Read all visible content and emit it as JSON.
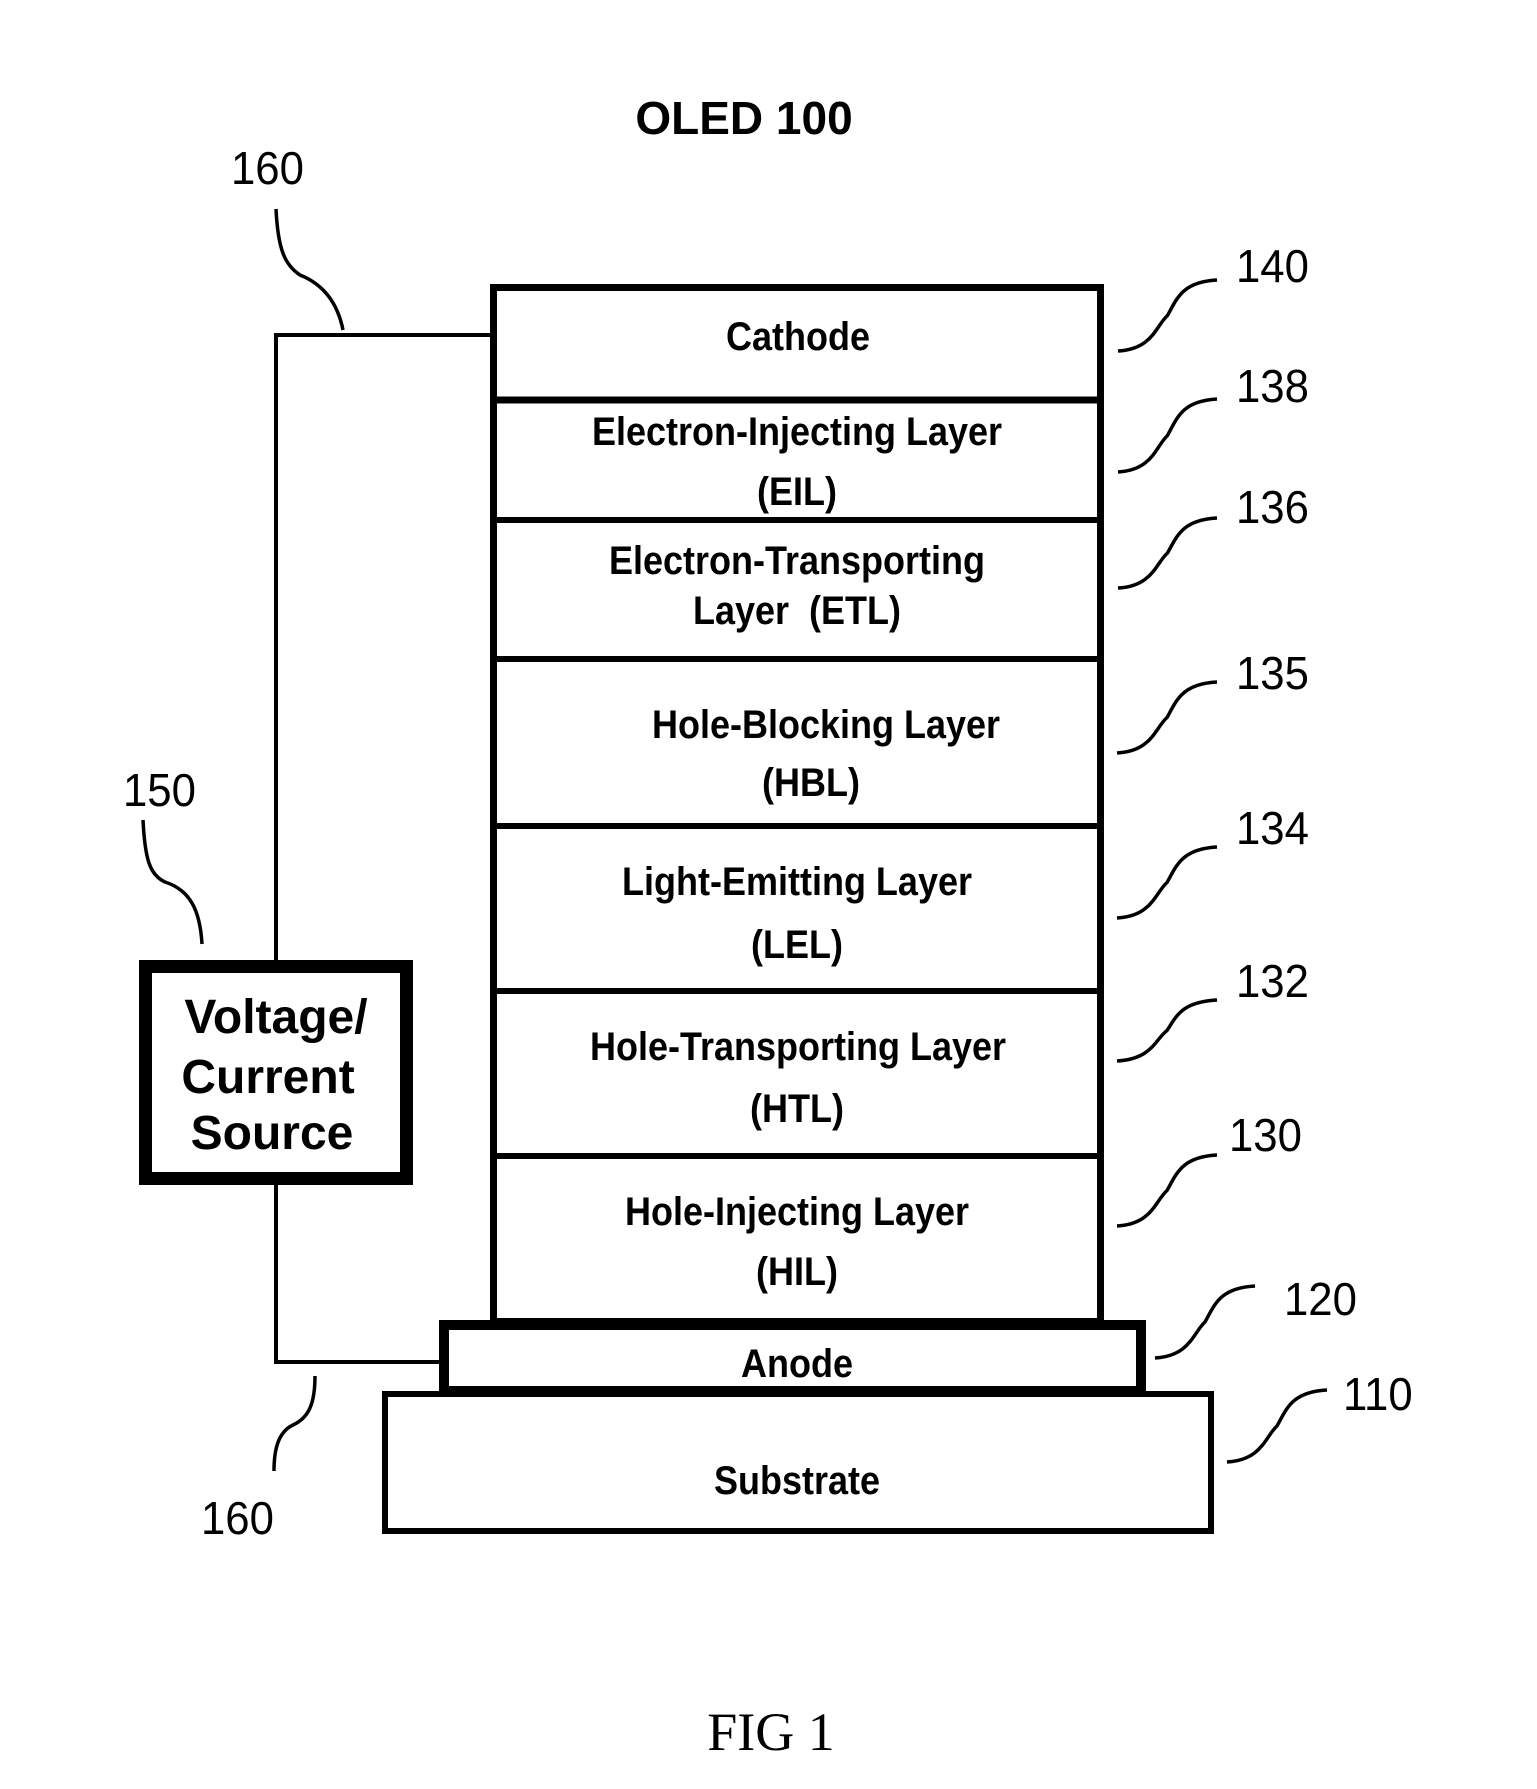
{
  "title": "OLED 100",
  "caption": "FIG 1",
  "colors": {
    "ink": "#000000",
    "background": "#ffffff"
  },
  "source": {
    "ref": "150",
    "lines": [
      "Voltage/",
      "Current",
      "Source"
    ]
  },
  "wires": {
    "top_ref": "160",
    "bottom_ref": "160"
  },
  "layers": [
    {
      "id": "cathode",
      "ref": "140",
      "lines": [
        "Cathode"
      ]
    },
    {
      "id": "eil",
      "ref": "138",
      "lines": [
        "Electron-Injecting Layer",
        "(EIL)"
      ]
    },
    {
      "id": "etl",
      "ref": "136",
      "lines": [
        "Electron-Transporting",
        "Layer  (ETL)"
      ]
    },
    {
      "id": "hbl",
      "ref": "135",
      "lines": [
        "Hole-Blocking Layer",
        "(HBL)"
      ]
    },
    {
      "id": "lel",
      "ref": "134",
      "lines": [
        "Light-Emitting Layer",
        "(LEL)"
      ]
    },
    {
      "id": "htl",
      "ref": "132",
      "lines": [
        "Hole-Transporting Layer",
        "(HTL)"
      ]
    },
    {
      "id": "hil",
      "ref": "130",
      "lines": [
        "Hole-Injecting Layer",
        "(HIL)"
      ]
    },
    {
      "id": "anode",
      "ref": "120",
      "lines": [
        "Anode"
      ]
    },
    {
      "id": "substrate",
      "ref": "110",
      "lines": [
        "Substrate"
      ]
    }
  ]
}
